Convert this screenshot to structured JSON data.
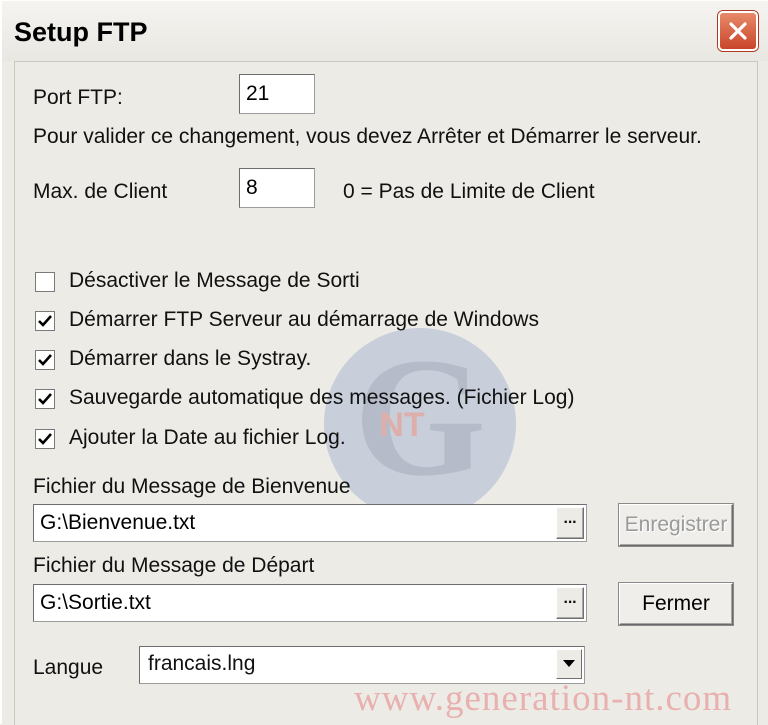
{
  "window": {
    "title": "Setup FTP",
    "close_icon": "close-icon"
  },
  "port": {
    "label": "Port FTP:",
    "value": "21",
    "note": "Pour valider ce changement, vous devez Arrêter et Démarrer le serveur."
  },
  "max_client": {
    "label": "Max. de Client",
    "value": "8",
    "hint": "0 = Pas de Limite de Client"
  },
  "options": [
    {
      "label": "Désactiver le Message de Sorti",
      "checked": false
    },
    {
      "label": "Démarrer FTP Serveur au démarrage de Windows",
      "checked": true
    },
    {
      "label": "Démarrer dans le Systray.",
      "checked": true
    },
    {
      "label": "Sauvegarde automatique des messages. (Fichier Log)",
      "checked": true
    },
    {
      "label": "Ajouter la Date au fichier Log.",
      "checked": true
    }
  ],
  "welcome_file": {
    "label": "Fichier du Message de Bienvenue",
    "value": "G:\\Bienvenue.txt",
    "browse_label": "···"
  },
  "departure_file": {
    "label": "Fichier du Message de Départ",
    "value": "G:\\Sortie.txt",
    "browse_label": "···"
  },
  "buttons": {
    "save_label": "Enregistrer",
    "close_label": "Fermer"
  },
  "language": {
    "label": "Langue",
    "selected": "francais.lng"
  },
  "watermark": {
    "text": "www.generation-nt.com",
    "logo_letter": "G",
    "logo_text": "NT"
  },
  "colors": {
    "check": "#000000",
    "close_button": "#c9452a",
    "watermark": "#e9b0b0"
  }
}
